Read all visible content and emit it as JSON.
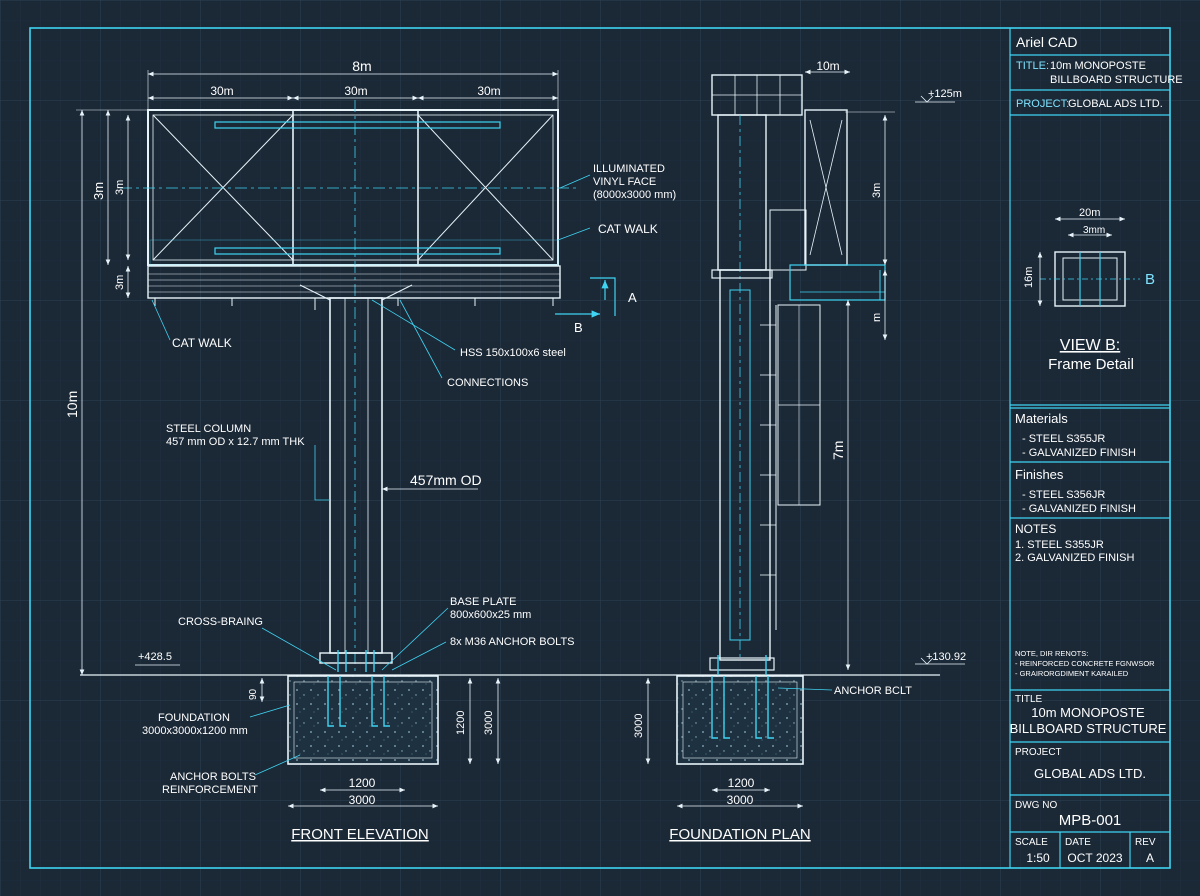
{
  "app_name": "Ariel CAD",
  "title_block": {
    "title_label": "TITLE:",
    "title_line1": "10m MONOPOSTE",
    "title_line2": "BILLBOARD STRUCTURE",
    "project_label": "PROJECT:",
    "project_value": "GLOBAL ADS LTD.",
    "view_b_dims": {
      "width": "20m",
      "inner": "3mm",
      "height": "16m",
      "marker": "B"
    },
    "view_b_title": "VIEW B:",
    "view_b_subtitle": "Frame Detail",
    "materials_header": "Materials",
    "materials": [
      "- STEEL S355JR",
      "- GALVANIZED FINISH"
    ],
    "finishes_header": "Finishes",
    "finishes": [
      "- STEEL S356JR",
      "- GALVANIZED FINISH"
    ],
    "notes_header": "NOTES",
    "notes": [
      "1. STEEL S355JR",
      "2. GALVANIZED FINISH"
    ],
    "note_small": [
      "NOTE, DIR RENOTS:",
      "- REINFORCED CONCRETE FGNWSOR",
      "- GRAIRORGDIMENT KARAILED"
    ],
    "title_hdr": "TITLE",
    "title_value1": "10m MONOPOSTE",
    "title_value2": "BILLBOARD STRUCTURE",
    "project_hdr": "PROJECT",
    "project_value2": "GLOBAL ADS LTD.",
    "dwg_no_hdr": "DWG NO",
    "dwg_no": "MPB-001",
    "scale_hdr": "SCALE",
    "scale": "1:50",
    "date_hdr": "DATE",
    "date": "OCT 2023",
    "rev_hdr": "REV",
    "rev": "A"
  },
  "front": {
    "dim_total_width": "8m",
    "dim_panels": [
      "30m",
      "30m",
      "30m"
    ],
    "dim_height_outer": "3m",
    "dim_height_inner": "3m",
    "dim_walk": "3m",
    "dim_column_height": "10m",
    "label_face_1": "ILLUMINATED",
    "label_face_2": "VINYL FACE",
    "label_face_3": "(8000x3000 mm)",
    "label_catwalk_right": "CAT WALK",
    "label_catwalk_left": "CAT WALK",
    "label_hss": "HSS 150x100x6 steel",
    "label_connections": "CONNECTIONS",
    "label_column_1": "STEEL COLUMN",
    "label_column_2": "457 mm OD x 12.7 mm THK",
    "label_od": "457mm OD",
    "label_base_1": "BASE PLATE",
    "label_base_2": "800x600x25 mm",
    "label_bolts": "8x M36 ANCHOR BOLTS",
    "label_bracing": "CROSS-BRAING",
    "level_left": "+428.5",
    "dim_90": "90",
    "label_foundation_1": "FOUNDATION",
    "label_foundation_2": "3000x3000x1200 mm",
    "label_anchor_1": "ANCHOR BOLTS",
    "label_anchor_2": "REINFORCEMENT",
    "dim_1200_v": "1200",
    "dim_3000_v": "3000",
    "dim_1200_h": "1200",
    "dim_3000_h": "3000",
    "section_a": "A",
    "section_b": "B",
    "view_title": "FRONT ELEVATION"
  },
  "side": {
    "dim_top": "10m",
    "dim_level": "+125m",
    "dim_3m": "3m",
    "dim_m": "m",
    "dim_7m": "7m",
    "level_right": "+130.92",
    "label_anchor": "ANCHOR BCLT",
    "dim_3000_v": "3000",
    "dim_1200_h": "1200",
    "dim_3000_h": "3000",
    "view_title": "FOUNDATION PLAN"
  },
  "colors": {
    "background": "#1b2836",
    "grid": "#26394a",
    "line_white": "#e8f4fa",
    "line_cyan": "#3fd4f2",
    "text_cyan": "#7fe3ff"
  }
}
